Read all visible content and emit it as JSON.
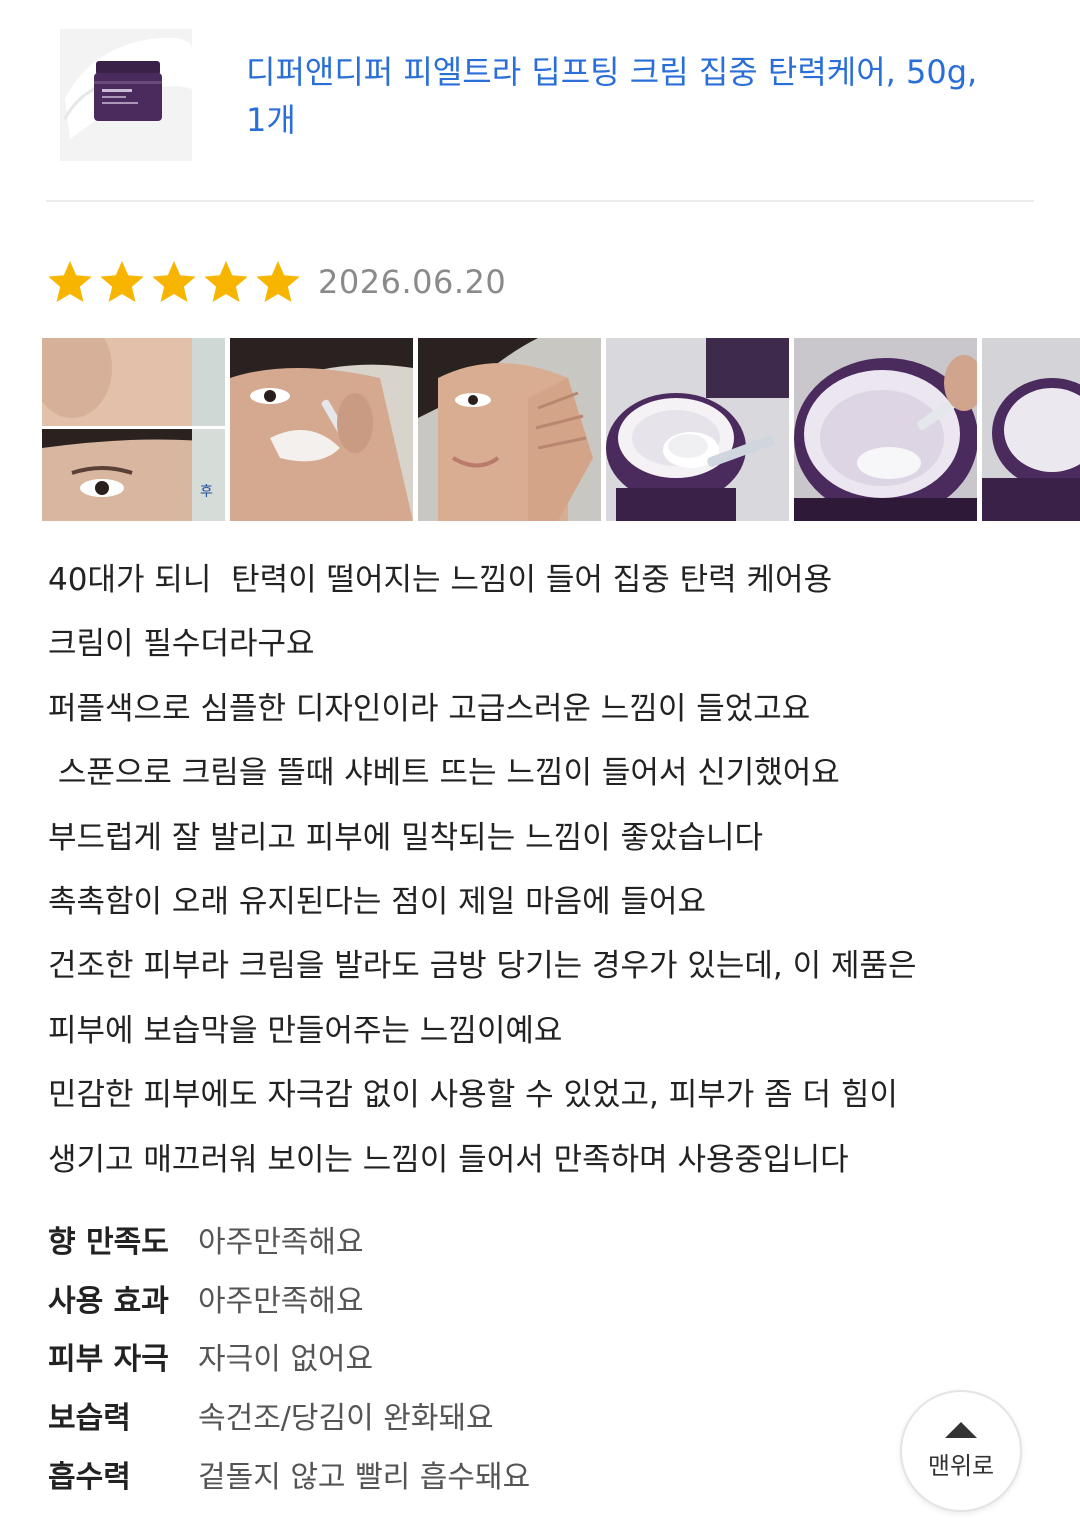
{
  "product": {
    "title_line1": "디퍼앤디퍼 피엘트라 딥프팅 크림 집중 탄력케어, 50g,",
    "title_line2": "1개",
    "thumbnail_icon": "cream-jar-image"
  },
  "review": {
    "rating": 5,
    "rating_max": 5,
    "star_color": "#f7b500",
    "date": "2026.06.20",
    "photos": [
      {
        "name": "before-after-face-photo",
        "caption": "후"
      },
      {
        "name": "applying-cream-photo"
      },
      {
        "name": "cheek-pat-photo"
      },
      {
        "name": "cream-on-spatula-photo"
      },
      {
        "name": "open-jar-texture-photo"
      },
      {
        "name": "jar-closeup-photo"
      }
    ],
    "body_lines": [
      "40대가 되니  탄력이 떨어지는 느낌이 들어 집중 탄력 케어용",
      "크림이 필수더라구요",
      "퍼플색으로 심플한 디자인이라 고급스러운 느낌이 들었고요",
      " 스푼으로 크림을 뜰때 샤베트 뜨는 느낌이 들어서 신기했어요",
      "부드럽게 잘 발리고 피부에 밀착되는 느낌이 좋았습니다",
      "촉촉함이 오래 유지된다는 점이 제일 마음에 들어요",
      "건조한 피부라 크림을 발라도 금방 당기는 경우가 있는데, 이 제품은",
      "피부에 보습막을 만들어주는 느낌이예요",
      "민감한 피부에도 자극감 없이 사용할 수 있었고, 피부가 좀 더 힘이",
      "생기고 매끄러워 보이는 느낌이 들어서 만족하며 사용중입니다"
    ],
    "attributes": [
      {
        "label": "향 만족도",
        "value": "아주만족해요"
      },
      {
        "label": "사용 효과",
        "value": "아주만족해요"
      },
      {
        "label": "피부 자극",
        "value": "자극이 없어요"
      },
      {
        "label": "보습력",
        "value": "속건조/당김이 완화돼요"
      },
      {
        "label": "흡수력",
        "value": "겉돌지 않고 빨리 흡수돼요"
      }
    ]
  },
  "top_button": {
    "label": "맨위로"
  },
  "colors": {
    "link": "#2a6fd8",
    "jar_purple": "#4b2a5e"
  }
}
